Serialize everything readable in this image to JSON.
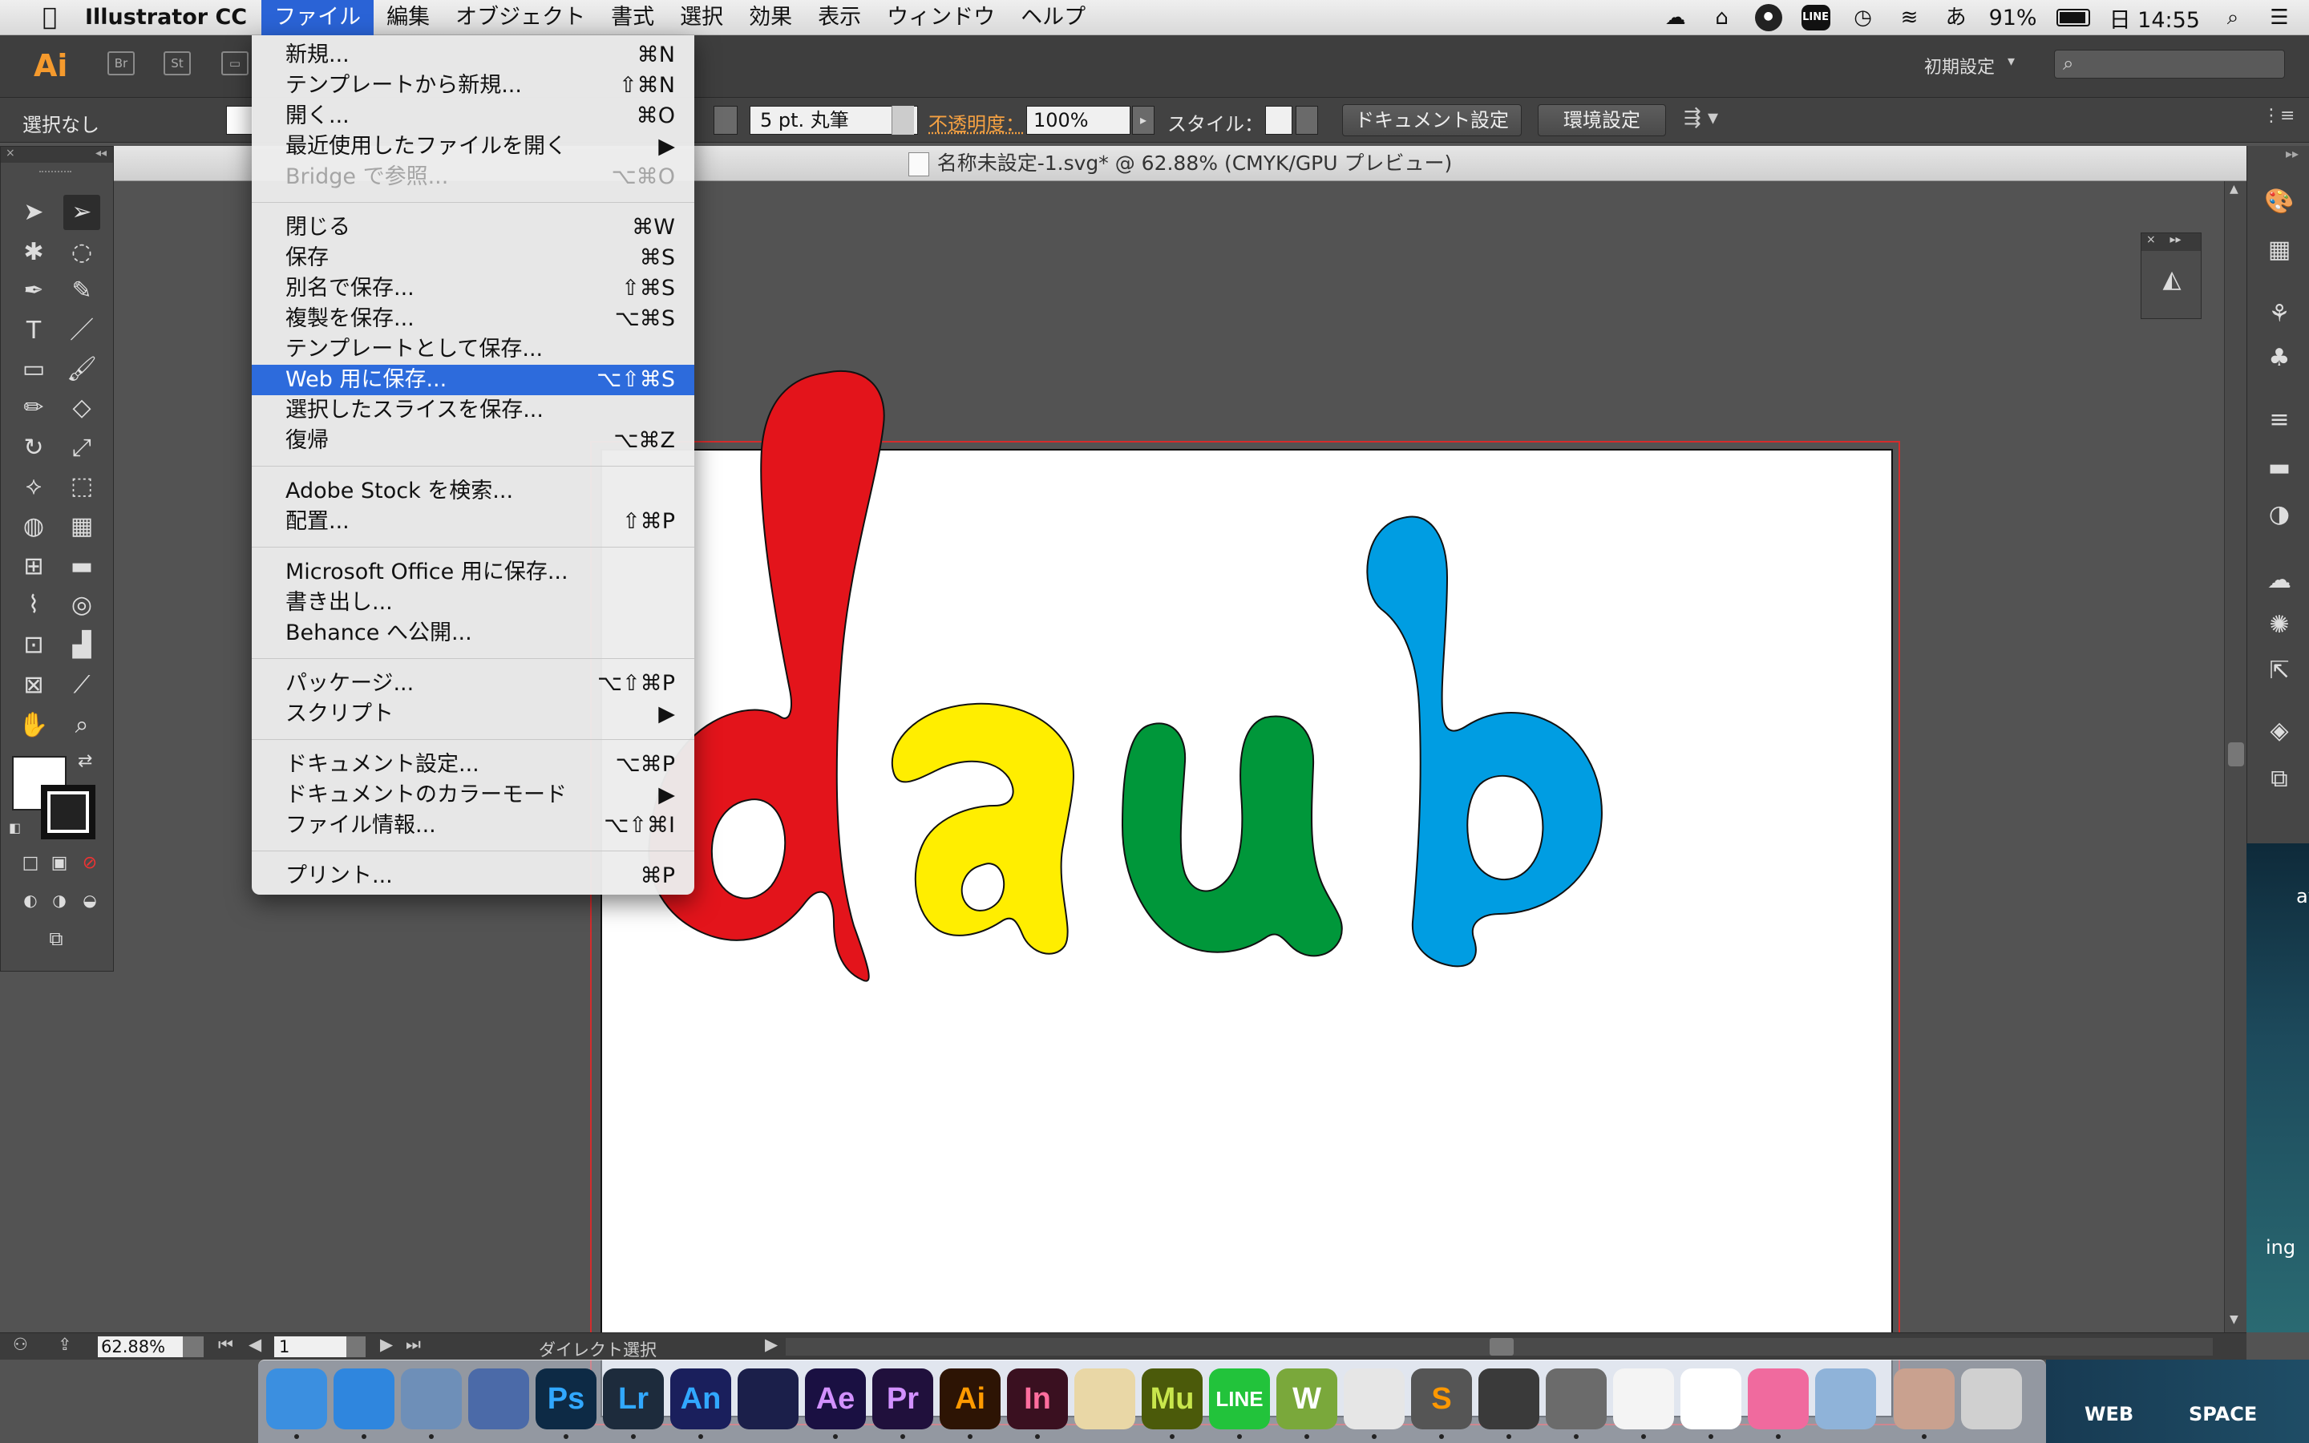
{
  "menubar": {
    "app_name": "Illustrator CC",
    "menus": [
      "ファイル",
      "編集",
      "オブジェクト",
      "書式",
      "選択",
      "効果",
      "表示",
      "ウィンドウ",
      "ヘルプ"
    ],
    "battery": "91%",
    "clock": "日 14:55",
    "line_label": "LINE",
    "ime": "あ"
  },
  "appbar": {
    "logo": "Ai",
    "bridge_btn": "Br",
    "stock_btn": "St",
    "workspace": "初期設定"
  },
  "controlbar": {
    "selection": "選択なし",
    "brush": "5 pt. 丸筆",
    "opacity_label": "不透明度：",
    "opacity_value": "100%",
    "style_label": "スタイル：",
    "doc_setup": "ドキュメント設定",
    "prefs": "環境設定"
  },
  "document": {
    "title": "名称未設定-1.svg* @ 62.88% (CMYK/GPU プレビュー)",
    "artwork_colors": {
      "d": "#e3141b",
      "a": "#ffee00",
      "u": "#00973a",
      "b": "#009de2"
    }
  },
  "statusbar": {
    "zoom": "62.88%",
    "page": "1",
    "tool": "ダイレクト選択"
  },
  "file_menu": {
    "groups": [
      [
        {
          "label": "新規...",
          "shortcut": "⌘N"
        },
        {
          "label": "テンプレートから新規...",
          "shortcut": "⇧⌘N"
        },
        {
          "label": "開く...",
          "shortcut": "⌘O"
        },
        {
          "label": "最近使用したファイルを開く",
          "shortcut": "▶"
        },
        {
          "label": "Bridge で参照...",
          "shortcut": "⌥⌘O",
          "disabled": true
        }
      ],
      [
        {
          "label": "閉じる",
          "shortcut": "⌘W"
        },
        {
          "label": "保存",
          "shortcut": "⌘S"
        },
        {
          "label": "別名で保存...",
          "shortcut": "⇧⌘S"
        },
        {
          "label": "複製を保存...",
          "shortcut": "⌥⌘S"
        },
        {
          "label": "テンプレートとして保存...",
          "shortcut": ""
        },
        {
          "label": "Web 用に保存...",
          "shortcut": "⌥⇧⌘S",
          "highlighted": true
        },
        {
          "label": "選択したスライスを保存...",
          "shortcut": ""
        },
        {
          "label": "復帰",
          "shortcut": "⌥⌘Z"
        }
      ],
      [
        {
          "label": "Adobe Stock を検索...",
          "shortcut": ""
        },
        {
          "label": "配置...",
          "shortcut": "⇧⌘P"
        }
      ],
      [
        {
          "label": "Microsoft Office 用に保存...",
          "shortcut": ""
        },
        {
          "label": "書き出し...",
          "shortcut": ""
        },
        {
          "label": "Behance へ公開...",
          "shortcut": ""
        }
      ],
      [
        {
          "label": "パッケージ...",
          "shortcut": "⌥⇧⌘P"
        },
        {
          "label": "スクリプト",
          "shortcut": "▶"
        }
      ],
      [
        {
          "label": "ドキュメント設定...",
          "shortcut": "⌥⌘P"
        },
        {
          "label": "ドキュメントのカラーモード",
          "shortcut": "▶"
        },
        {
          "label": "ファイル情報...",
          "shortcut": "⌥⇧⌘I"
        }
      ],
      [
        {
          "label": "プリント...",
          "shortcut": "⌘P"
        }
      ]
    ]
  },
  "desktop": {
    "labels": [
      "WEB",
      "SPACE",
      "ing",
      "av"
    ]
  },
  "dock": {
    "apps": [
      {
        "label": "",
        "color": "#3b8fe0",
        "icon": "finder-icon"
      },
      {
        "label": "",
        "color": "#2f86de",
        "icon": "safari-icon"
      },
      {
        "label": "",
        "color": "#6e8fb8",
        "icon": "preview-icon"
      },
      {
        "label": "",
        "color": "#4b6aa8",
        "icon": "xcode-icon"
      },
      {
        "label": "Ps",
        "color": "#0d2a45",
        "icon": "photoshop-icon"
      },
      {
        "label": "Lr",
        "color": "#1d2b3c",
        "icon": "lightroom-icon"
      },
      {
        "label": "An",
        "color": "#1a1f5c",
        "icon": "animate-icon"
      },
      {
        "label": "",
        "color": "#1b1f4a",
        "icon": "media-encoder-icon"
      },
      {
        "label": "Ae",
        "color": "#1a1042",
        "icon": "after-effects-icon"
      },
      {
        "label": "Pr",
        "color": "#20103c",
        "icon": "premiere-icon"
      },
      {
        "label": "Ai",
        "color": "#2d1404",
        "icon": "illustrator-icon"
      },
      {
        "label": "In",
        "color": "#3a1020",
        "icon": "indesign-icon"
      },
      {
        "label": "",
        "color": "#e9d7a6",
        "icon": "pages-icon"
      },
      {
        "label": "Mu",
        "color": "#4b5a0a",
        "icon": "muse-icon"
      },
      {
        "label": "LINE",
        "color": "#22c33b",
        "icon": "line-icon"
      },
      {
        "label": "W",
        "color": "#7aa83b",
        "icon": "wordpress-icon"
      },
      {
        "label": "",
        "color": "#e6e6e6",
        "icon": "numbers-icon"
      },
      {
        "label": "S",
        "color": "#555555",
        "icon": "sublime-icon"
      },
      {
        "label": "",
        "color": "#3a3a3a",
        "icon": "compressor-icon"
      },
      {
        "label": "",
        "color": "#6b6b6b",
        "icon": "system-prefs-icon"
      },
      {
        "label": "",
        "color": "#f4f4f4",
        "icon": "notes-icon"
      },
      {
        "label": "",
        "color": "#ffffff",
        "icon": "alpaca-icon"
      },
      {
        "label": "",
        "color": "#f06a9e",
        "icon": "itunes-icon"
      },
      {
        "label": "",
        "color": "#8fb3d9",
        "icon": "photos-icon"
      },
      {
        "label": "",
        "color": "#c9a18f",
        "icon": "user-photo-icon"
      },
      {
        "label": "",
        "color": "#d0d0d0",
        "icon": "trash-icon"
      }
    ]
  }
}
